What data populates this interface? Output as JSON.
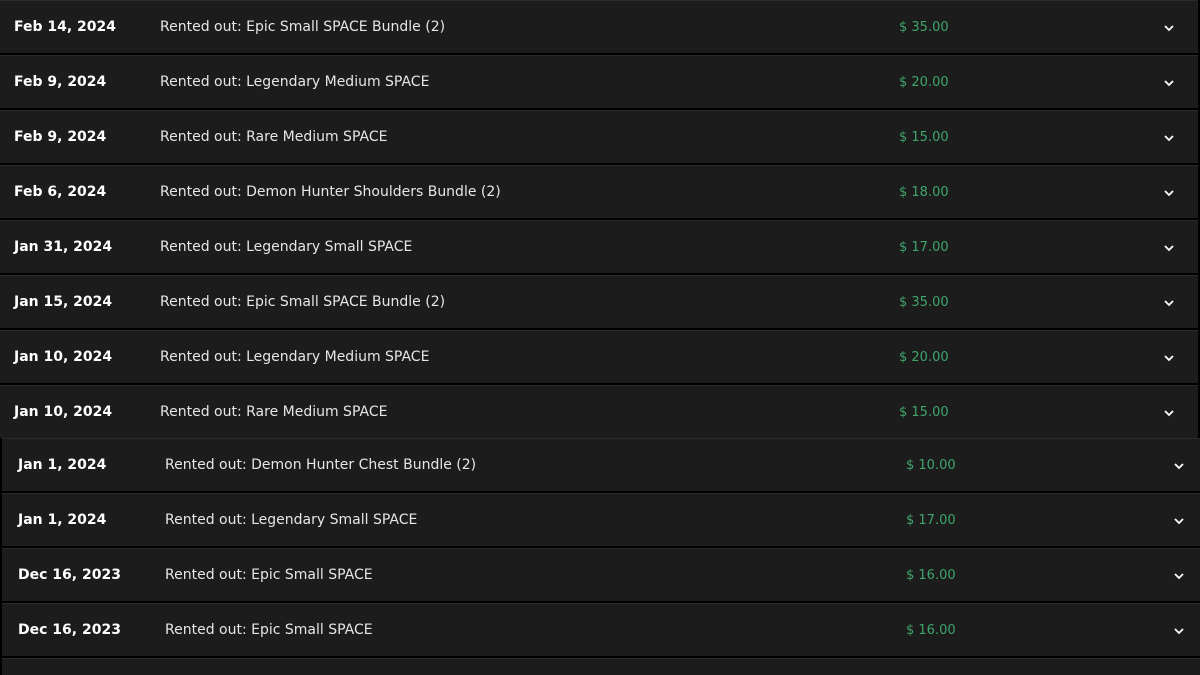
{
  "colors": {
    "background": "#1c1c1c",
    "separator": "#000000",
    "amount": "#3fa56a",
    "text": "#ffffff"
  },
  "icon": "chevron-down-icon",
  "rows": [
    {
      "date": "Feb 14, 2024",
      "description": "Rented out: Epic Small SPACE Bundle (2)",
      "amount": "$ 35.00"
    },
    {
      "date": "Feb 9, 2024",
      "description": "Rented out: Legendary Medium SPACE",
      "amount": "$ 20.00"
    },
    {
      "date": "Feb 9, 2024",
      "description": "Rented out: Rare Medium SPACE",
      "amount": "$ 15.00"
    },
    {
      "date": "Feb 6, 2024",
      "description": "Rented out: Demon Hunter Shoulders Bundle (2)",
      "amount": "$ 18.00"
    },
    {
      "date": "Jan 31, 2024",
      "description": "Rented out: Legendary Small SPACE",
      "amount": "$ 17.00"
    },
    {
      "date": "Jan 15, 2024",
      "description": "Rented out: Epic Small SPACE Bundle (2)",
      "amount": "$ 35.00"
    },
    {
      "date": "Jan 10, 2024",
      "description": "Rented out: Legendary Medium SPACE",
      "amount": "$ 20.00"
    },
    {
      "date": "Jan 10, 2024",
      "description": "Rented out: Rare Medium SPACE",
      "amount": "$ 15.00"
    },
    {
      "date": "Jan 1, 2024",
      "description": "Rented out: Demon Hunter Chest Bundle (2)",
      "amount": "$ 10.00"
    },
    {
      "date": "Jan 1, 2024",
      "description": "Rented out: Legendary Small SPACE",
      "amount": "$ 17.00"
    },
    {
      "date": "Dec 16, 2023",
      "description": "Rented out: Epic Small SPACE",
      "amount": "$ 16.00"
    },
    {
      "date": "Dec 16, 2023",
      "description": "Rented out: Epic Small SPACE",
      "amount": "$ 16.00"
    }
  ]
}
